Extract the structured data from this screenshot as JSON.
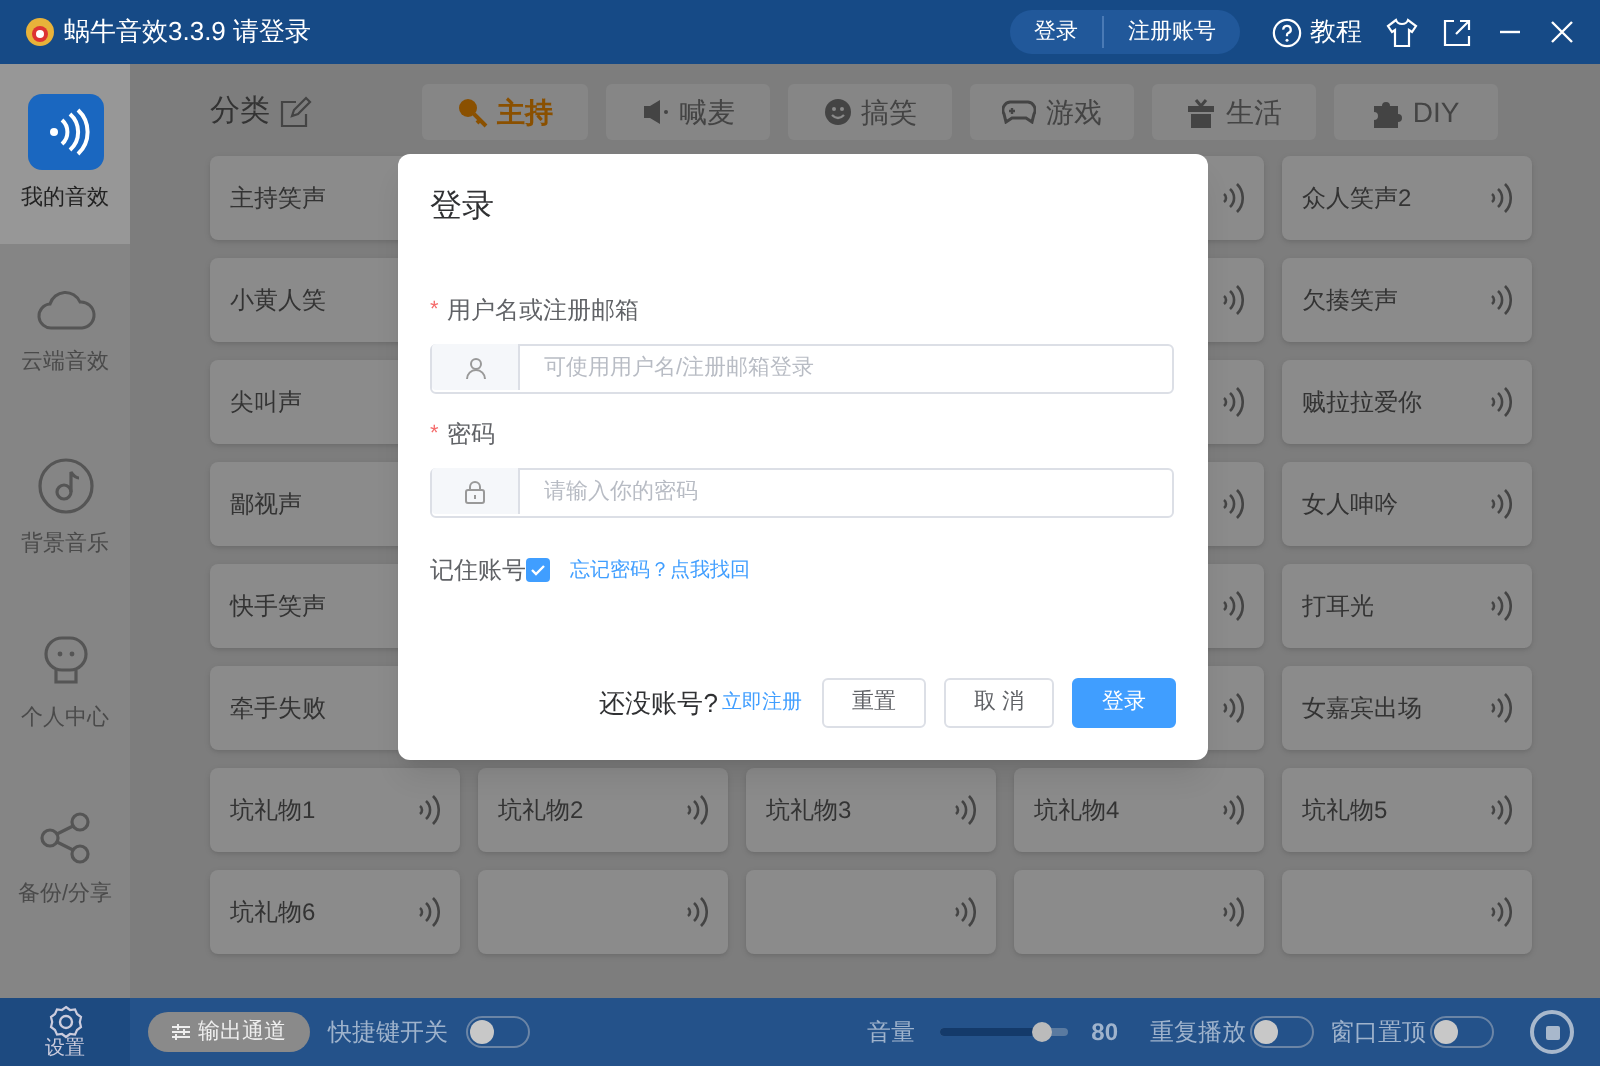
{
  "window": {
    "title": "蜗牛音效3.3.9 请登录",
    "account_buttons": [
      "登录",
      "注册账号"
    ],
    "help": "教程"
  },
  "sidebar": {
    "items": [
      {
        "kind": "mine",
        "label": "我的音效",
        "selected": true
      },
      {
        "kind": "cloud",
        "label": "云端音效",
        "selected": false
      },
      {
        "kind": "music",
        "label": "背景音乐",
        "selected": false
      },
      {
        "kind": "person",
        "label": "个人中心",
        "selected": false
      },
      {
        "kind": "share",
        "label": "备份/分享",
        "selected": false
      }
    ],
    "settings": "设置"
  },
  "category_label": "分类",
  "tabs": [
    {
      "kind": "host",
      "label": "主持",
      "selected": true
    },
    {
      "kind": "mic",
      "label": "喊麦",
      "selected": false
    },
    {
      "kind": "funny",
      "label": "搞笑",
      "selected": false
    },
    {
      "kind": "game",
      "label": "游戏",
      "selected": false
    },
    {
      "kind": "life",
      "label": "生活",
      "selected": false
    },
    {
      "kind": "diy",
      "label": "DIY",
      "selected": false
    }
  ],
  "grid": {
    "rows": [
      [
        {
          "label": "主持笑声",
          "sound_icon": false
        },
        null,
        null,
        {
          "sound_icon": true
        },
        {
          "label": "众人笑声2",
          "sound_icon": true
        }
      ],
      [
        {
          "label": "小黄人笑",
          "sound_icon": false
        },
        null,
        null,
        {
          "sound_icon": true
        },
        {
          "label": "欠揍笑声",
          "sound_icon": true
        }
      ],
      [
        {
          "label": "尖叫声",
          "sound_icon": false
        },
        null,
        null,
        {
          "sound_icon": true
        },
        {
          "label": "贼拉拉爱你",
          "sound_icon": true
        }
      ],
      [
        {
          "label": "鄙视声",
          "sound_icon": false
        },
        null,
        null,
        {
          "sound_icon": true
        },
        {
          "label": "女人呻吟",
          "sound_icon": true
        }
      ],
      [
        {
          "label": "快手笑声",
          "sound_icon": false
        },
        null,
        null,
        {
          "sound_icon": true
        },
        {
          "label": "打耳光",
          "sound_icon": true
        }
      ],
      [
        {
          "label": "牵手失败",
          "sound_icon": false
        },
        null,
        null,
        {
          "sound_icon": true
        },
        {
          "label": "女嘉宾出场",
          "sound_icon": true
        }
      ],
      [
        {
          "label": "坑礼物1",
          "sound_icon": true
        },
        {
          "label": "坑礼物2",
          "sound_icon": true
        },
        {
          "label": "坑礼物3",
          "sound_icon": true
        },
        {
          "label": "坑礼物4",
          "sound_icon": true
        },
        {
          "label": "坑礼物5",
          "sound_icon": true
        }
      ],
      [
        {
          "label": "坑礼物6",
          "sound_icon": true
        },
        {
          "sound_icon": true
        },
        {
          "sound_icon": true
        },
        {
          "sound_icon": true
        },
        {
          "sound_icon": true
        }
      ]
    ]
  },
  "bottom_bar": {
    "output_button": "输出通道",
    "hotkey": {
      "label": "快捷键开关",
      "on": false
    },
    "volume": {
      "label": "音量",
      "level": 0.8,
      "reading": "80"
    },
    "repeat": {
      "label": "重复播放",
      "on": false
    },
    "pin_top": {
      "label": "窗口置顶",
      "on": false
    }
  },
  "login_dialog": {
    "title": "登录",
    "username": {
      "label": "用户名或注册邮箱",
      "required_mark": "*",
      "placeholder": "可使用用户名/注册邮箱登录"
    },
    "password": {
      "label": "密码",
      "required_mark": "*",
      "placeholder": "请输入你的密码"
    },
    "remember": {
      "label": "记住账号",
      "checked": true
    },
    "forgot_link": "忘记密码？点我找回",
    "no_account": "还没账号?",
    "register_link": "立即注册",
    "buttons": [
      {
        "kind": "plain",
        "label": "重置"
      },
      {
        "kind": "plain",
        "label": "取 消"
      },
      {
        "kind": "primary",
        "label": "登录"
      }
    ]
  }
}
